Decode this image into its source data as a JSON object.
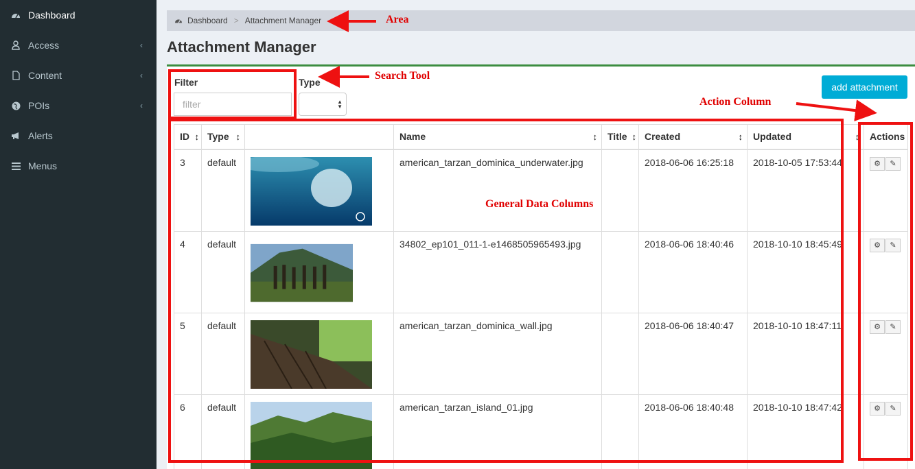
{
  "sidebar": {
    "items": [
      {
        "label": "Dashboard",
        "icon": "dashboard-icon",
        "has_submenu": false
      },
      {
        "label": "Access",
        "icon": "user-icon",
        "has_submenu": true
      },
      {
        "label": "Content",
        "icon": "file-icon",
        "has_submenu": true
      },
      {
        "label": "POIs",
        "icon": "globe-icon",
        "has_submenu": true
      },
      {
        "label": "Alerts",
        "icon": "bullhorn-icon",
        "has_submenu": false
      },
      {
        "label": "Menus",
        "icon": "bars-icon",
        "has_submenu": false
      }
    ],
    "chevron": "‹"
  },
  "breadcrumb": {
    "root": "Dashboard",
    "separator": ">",
    "current": "Attachment Manager"
  },
  "page_title": "Attachment Manager",
  "filters": {
    "filter_label": "Filter",
    "filter_placeholder": "filter",
    "filter_value": "",
    "type_label": "Type",
    "type_value": ""
  },
  "toolbar": {
    "add_label": "add attachment"
  },
  "table": {
    "headers": {
      "id": "ID",
      "type": "Type",
      "image": "",
      "name": "Name",
      "title": "Title",
      "created": "Created",
      "updated": "Updated",
      "actions": "Actions"
    },
    "rows": [
      {
        "id": "3",
        "type": "default",
        "name": "american_tarzan_dominica_underwater.jpg",
        "title": "",
        "created": "2018-06-06 16:25:18",
        "updated": "2018-10-05 17:53:44"
      },
      {
        "id": "4",
        "type": "default",
        "name": "34802_ep101_011-1-e1468505965493.jpg",
        "title": "",
        "created": "2018-06-06 18:40:46",
        "updated": "2018-10-10 18:45:49"
      },
      {
        "id": "5",
        "type": "default",
        "name": "american_tarzan_dominica_wall.jpg",
        "title": "",
        "created": "2018-06-06 18:40:47",
        "updated": "2018-10-10 18:47:11"
      },
      {
        "id": "6",
        "type": "default",
        "name": "american_tarzan_island_01.jpg",
        "title": "",
        "created": "2018-06-06 18:40:48",
        "updated": "2018-10-10 18:47:42"
      }
    ]
  },
  "annotations": {
    "area": "Area",
    "search_tool": "Search Tool",
    "action_column": "Action Column",
    "general_data_columns": "General Data Columns"
  },
  "colors": {
    "sidebar_bg": "#222d32",
    "accent_green": "#3c8d40",
    "button_blue": "#00acd6",
    "annotation_red": "#ee1111"
  }
}
